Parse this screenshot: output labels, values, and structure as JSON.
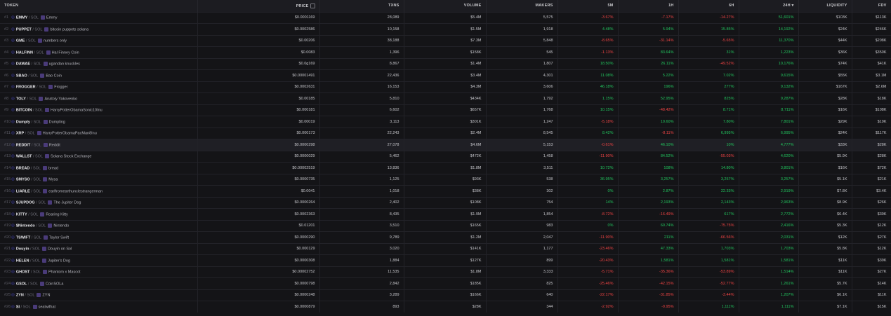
{
  "header": {
    "token": "TOKEN",
    "price": "PRICE",
    "txns": "TXNS",
    "volume": "VOLUME",
    "makers": "MAKERS",
    "m5": "5M",
    "h1": "1H",
    "h6": "6H",
    "h24": "24H ▾",
    "liquidity": "LIQUIDITY",
    "fdv": "FDV"
  },
  "colors": {
    "positive": "#22c55e",
    "negative": "#ef4444",
    "accent": "#4b4bd0"
  },
  "rows": [
    {
      "rank": "#1",
      "symbol": "EMMY",
      "chain": "SOL",
      "name": "Emmy",
      "price": "$0.0001169",
      "txns": "28,089",
      "volume": "$5.4M",
      "makers": "5,575",
      "m5": "-3.67%",
      "h1": "-7.17%",
      "h6": "-14.27%",
      "h24": "51,601%",
      "liquidity": "$103K",
      "fdv": "$113K"
    },
    {
      "rank": "#2",
      "symbol": "PUPPET",
      "chain": "SOL",
      "name": "bitcoin puppets solana",
      "price": "$0.0002586",
      "txns": "10,158",
      "volume": "$1.5M",
      "makers": "1,918",
      "m5": "4.48%",
      "h1": "5.94%",
      "h6": "15.85%",
      "h24": "14,192%",
      "liquidity": "$24K",
      "fdv": "$246K"
    },
    {
      "rank": "#3",
      "symbol": "GME",
      "chain": "SOL",
      "name": "numbers only",
      "price": "$0.00206",
      "txns": "38,188",
      "volume": "$7.3M",
      "makers": "5,848",
      "m5": "-8.65%",
      "h1": "-31.14%",
      "h6": "-5.65%",
      "h24": "11,370%",
      "liquidity": "$44K",
      "fdv": "$208K"
    },
    {
      "rank": "#4",
      "symbol": "HALFINN",
      "chain": "SOL",
      "name": "Hal Finney Coin",
      "price": "$0.0083",
      "txns": "1,396",
      "volume": "$158K",
      "makers": "545",
      "m5": "-1.13%",
      "h1": "83.64%",
      "h6": "31%",
      "h24": "1,223%",
      "liquidity": "$36K",
      "fdv": "$350K"
    },
    {
      "rank": "#5",
      "symbol": "DAWAE",
      "chain": "SOL",
      "name": "ugandan knuckles",
      "price": "$0.0g169",
      "txns": "8,867",
      "volume": "$1.4M",
      "makers": "1,807",
      "m5": "18.50%",
      "h1": "26.11%",
      "h6": "-49.52%",
      "h24": "10,176%",
      "liquidity": "$74K",
      "fdv": "$41K"
    },
    {
      "rank": "#6",
      "symbol": "SBAO",
      "chain": "SOL",
      "name": "Bao Coin",
      "price": "$0.00001491",
      "txns": "22,436",
      "volume": "$3.4M",
      "makers": "4,301",
      "m5": "11.08%",
      "h1": "5.22%",
      "h6": "7.02%",
      "h24": "9,615%",
      "liquidity": "$55K",
      "fdv": "$3.1M"
    },
    {
      "rank": "#7",
      "symbol": "FROGGER",
      "chain": "SOL",
      "name": "Frogger",
      "price": "$0.0002631",
      "txns": "16,153",
      "volume": "$4.3M",
      "makers": "3,606",
      "m5": "46.18%",
      "h1": "196%",
      "h6": "277%",
      "h24": "9,132%",
      "liquidity": "$167K",
      "fdv": "$2.6M"
    },
    {
      "rank": "#8",
      "symbol": "TOLY",
      "chain": "SOL",
      "name": "Anatoly Yakovenko",
      "price": "$0.00185",
      "txns": "5,810",
      "volume": "$434K",
      "makers": "1,792",
      "m5": "1.15%",
      "h1": "52.95%",
      "h6": "825%",
      "h24": "9,287%",
      "liquidity": "$28K",
      "fdv": "$18K"
    },
    {
      "rank": "#9",
      "symbol": "BITCOIN",
      "chain": "SOL",
      "name": "HarryPotterObamaSonic10Inu",
      "price": "$0.000181",
      "txns": "6,602",
      "volume": "$657K",
      "makers": "1,768",
      "m5": "10.15%",
      "h1": "-48.42%",
      "h6": "8.71%",
      "h24": "8,711%",
      "liquidity": "$16K",
      "fdv": "$108K"
    },
    {
      "rank": "#10",
      "symbol": "Dumply",
      "chain": "SOL",
      "name": "Dumpling",
      "price": "$0.00019",
      "txns": "3,113",
      "volume": "$301K",
      "makers": "1,247",
      "m5": "-5.18%",
      "h1": "10.60%",
      "h6": "7.80%",
      "h24": "7,801%",
      "liquidity": "$29K",
      "fdv": "$19K"
    },
    {
      "rank": "#11",
      "symbol": "XRP",
      "chain": "SOL",
      "name": "HarryPotterObamaPacMan8Inu",
      "price": "$0.000173",
      "txns": "22,243",
      "volume": "$2.4M",
      "makers": "8,545",
      "m5": "8.42%",
      "h1": "-8.11%",
      "h6": "6,995%",
      "h24": "6,995%",
      "liquidity": "$24K",
      "fdv": "$117K"
    },
    {
      "rank": "#12",
      "symbol": "REDDIT",
      "chain": "SOL",
      "name": "Reddit",
      "price": "$0.0000298",
      "txns": "27,078",
      "volume": "$4.6M",
      "makers": "5,153",
      "m5": "-0.61%",
      "h1": "46.10%",
      "h6": "10%",
      "h24": "4,777%",
      "liquidity": "$33K",
      "fdv": "$28K"
    },
    {
      "rank": "#13",
      "symbol": "WALLST",
      "chain": "SOL",
      "name": "Solana Stock Exchange",
      "price": "$0.0000029",
      "txns": "5,462",
      "volume": "$472K",
      "makers": "1,458",
      "m5": "-11.90%",
      "h1": "84.52%",
      "h6": "-55.03%",
      "h24": "4,620%",
      "liquidity": "$5.9K",
      "fdv": "$28K"
    },
    {
      "rank": "#14",
      "symbol": "BREAD",
      "chain": "SOL",
      "name": "bread",
      "price": "$0.00002519",
      "txns": "13,836",
      "volume": "$1.8M",
      "makers": "3,511",
      "m5": "10.72%",
      "h1": "108%",
      "h6": "14.80%",
      "h24": "3,801%",
      "liquidity": "$16K",
      "fdv": "$72K"
    },
    {
      "rank": "#15",
      "symbol": "SMYSO",
      "chain": "SOL",
      "name": "Mysa",
      "price": "$0.0000735",
      "txns": "1,125",
      "volume": "$93K",
      "makers": "538",
      "m5": "36.95%",
      "h1": "3,257%",
      "h6": "3,257%",
      "h24": "3,257%",
      "liquidity": "$5.1K",
      "fdv": "$21K"
    },
    {
      "rank": "#16",
      "symbol": "LIARLE",
      "chain": "SOL",
      "name": "earlfromearthunclestrangerman",
      "price": "$0.0041",
      "txns": "1,018",
      "volume": "$38K",
      "makers": "302",
      "m5": "0%",
      "h1": "2.87%",
      "h6": "22.33%",
      "h24": "2,919%",
      "liquidity": "$7.8K",
      "fdv": "$3.4K"
    },
    {
      "rank": "#17",
      "symbol": "SJUPDOG",
      "chain": "SOL",
      "name": "The Jupiter Dog",
      "price": "$0.0000264",
      "txns": "2,402",
      "volume": "$108K",
      "makers": "754",
      "m5": "14%",
      "h1": "2,193%",
      "h6": "2,143%",
      "h24": "2,963%",
      "liquidity": "$8.9K",
      "fdv": "$26K"
    },
    {
      "rank": "#18",
      "symbol": "KITTY",
      "chain": "SOL",
      "name": "Roaring Kitty",
      "price": "$0.0002363",
      "txns": "8,435",
      "volume": "$1.9M",
      "makers": "1,854",
      "m5": "-8.72%",
      "h1": "-16.49%",
      "h6": "617%",
      "h24": "2,772%",
      "liquidity": "$6.4K",
      "fdv": "$39K"
    },
    {
      "rank": "#19",
      "symbol": "$Nintendo",
      "chain": "SOL",
      "name": "Nintendo",
      "price": "$0.01201",
      "txns": "3,510",
      "volume": "$165K",
      "makers": "983",
      "m5": "0%",
      "h1": "60.74%",
      "h6": "-75.75%",
      "h24": "2,416%",
      "liquidity": "$5.3K",
      "fdv": "$12K"
    },
    {
      "rank": "#20",
      "symbol": "TSWIFT",
      "chain": "SOL",
      "name": "Taylor Swift",
      "price": "$0.0000290",
      "txns": "9,789",
      "volume": "$1.2M",
      "makers": "2,047",
      "m5": "-11.90%",
      "h1": "211%",
      "h6": "-66.56%",
      "h24": "2,031%",
      "liquidity": "$12K",
      "fdv": "$27K"
    },
    {
      "rank": "#21",
      "symbol": "Douyin",
      "chain": "SOL",
      "name": "Douyin on Sol",
      "price": "$0.000129",
      "txns": "3,020",
      "volume": "$141K",
      "makers": "1,177",
      "m5": "-23.46%",
      "h1": "47.33%",
      "h6": "1,703%",
      "h24": "1,703%",
      "liquidity": "$5.8K",
      "fdv": "$12K"
    },
    {
      "rank": "#22",
      "symbol": "HELEN",
      "chain": "SOL",
      "name": "Jupiter's Dog",
      "price": "$0.0000308",
      "txns": "1,884",
      "volume": "$127K",
      "makers": "899",
      "m5": "-20.43%",
      "h1": "1,581%",
      "h6": "1,581%",
      "h24": "1,581%",
      "liquidity": "$11K",
      "fdv": "$39K"
    },
    {
      "rank": "#23",
      "symbol": "GHOST",
      "chain": "SOL",
      "name": "Phantom x Mascot",
      "price": "$0.00002752",
      "txns": "11,535",
      "volume": "$1.8M",
      "makers": "3,333",
      "m5": "-5.71%",
      "h1": "-35.36%",
      "h6": "-53.89%",
      "h24": "1,514%",
      "liquidity": "$11K",
      "fdv": "$27K"
    },
    {
      "rank": "#24",
      "symbol": "GSOL",
      "chain": "SOL",
      "name": "CoinSOLa",
      "price": "$0.0000798",
      "txns": "2,842",
      "volume": "$185K",
      "makers": "825",
      "m5": "-25.46%",
      "h1": "-42.15%",
      "h6": "-52.77%",
      "h24": "1,261%",
      "liquidity": "$5.7K",
      "fdv": "$14K"
    },
    {
      "rank": "#25",
      "symbol": "ZYN",
      "chain": "SOL",
      "name": "ZYN",
      "price": "$0.0000248",
      "txns": "3,289",
      "volume": "$166K",
      "makers": "640",
      "m5": "-22.17%",
      "h1": "-31.85%",
      "h6": "-3.44%",
      "h24": "1,207%",
      "liquidity": "$6.1K",
      "fdv": "$11K"
    },
    {
      "rank": "#26",
      "symbol": "SI",
      "chain": "SOL",
      "name": "sealwifhat",
      "price": "$0.0000879",
      "txns": "893",
      "volume": "$28K",
      "makers": "344",
      "m5": "-2.92%",
      "h1": "-0.95%",
      "h6": "1,111%",
      "h24": "1,111%",
      "liquidity": "$7.1K",
      "fdv": "$15K"
    }
  ]
}
